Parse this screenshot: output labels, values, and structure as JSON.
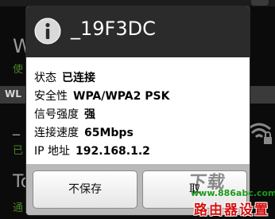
{
  "background": {
    "item1_title": "W",
    "item1_summary": "使",
    "section_header": "WL",
    "item2_title": "_",
    "item2_summary": "已",
    "item3_title": "To",
    "item3_summary": "通"
  },
  "dialog": {
    "icon": "info-icon",
    "title": "_19F3DC",
    "rows": [
      {
        "label": "状态",
        "value": "已连接"
      },
      {
        "label": "安全性",
        "value": "WPA/WPA2 PSK"
      },
      {
        "label": "信号强度",
        "value": "强"
      },
      {
        "label": "连接速度",
        "value": "65Mbps"
      },
      {
        "label": "IP 地址",
        "value": "192.168.1.2"
      }
    ],
    "buttons": {
      "forget": "不保存",
      "connect": "取"
    }
  },
  "watermark": {
    "logo": "下载",
    "url": "www.886abc.com",
    "name": "路由器设置"
  },
  "colors": {
    "dialog_header": "#2b2b2b",
    "dialog_body": "#ffffff",
    "dialog_footer": "#b9b9b9",
    "summary_green": "#4a7f2a",
    "watermark_red": "#d41111",
    "watermark_green": "#1a9a1a"
  }
}
